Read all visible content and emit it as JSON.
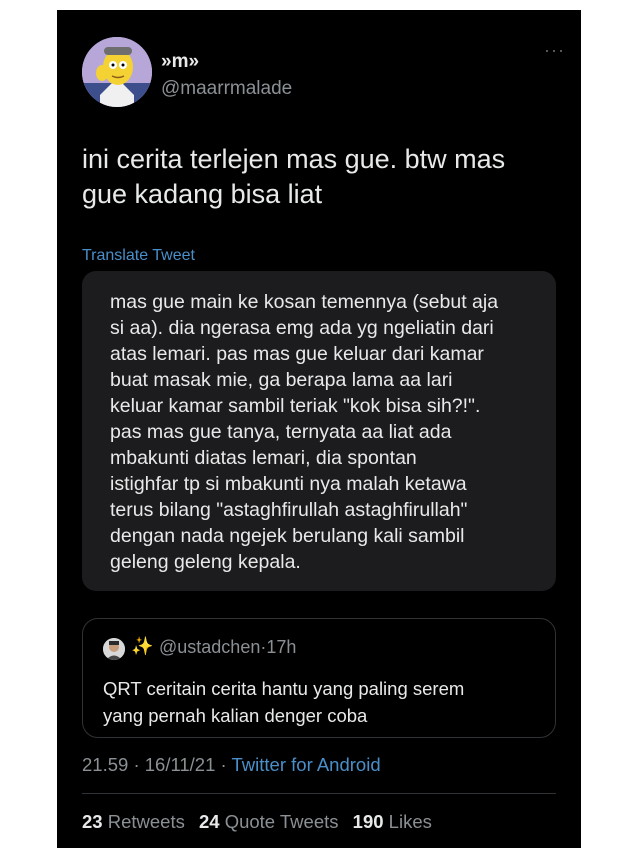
{
  "author": {
    "display_name": "»m»",
    "handle": "@maarrmalade"
  },
  "more_label": "···",
  "tweet_text": "ini cerita terlejen mas gue. btw mas\ngue kadang bisa liat",
  "translate_label": "Translate Tweet",
  "media_text": "mas gue main ke kosan temennya (sebut aja\nsi aa). dia ngerasa emg ada yg ngeliatin dari\natas lemari. pas mas gue keluar dari kamar\nbuat masak mie, ga berapa lama aa lari\nkeluar kamar sambil teriak \"kok bisa sih?!\".\npas mas gue tanya, ternyata aa liat ada\nmbakunti diatas lemari, dia spontan\nistighfar tp si mbakunti nya malah ketawa\nterus bilang \"astaghfirullah astaghfirullah\"\ndengan nada ngejek berulang kali sambil\ngeleng geleng kepala.",
  "quote": {
    "sparkle": "✨",
    "handle": "@ustadchen",
    "separator": "·",
    "time": "17h",
    "text": "QRT ceritain cerita hantu yang paling serem\nyang pernah kalian denger coba"
  },
  "meta": {
    "time": "21.59",
    "sep1": "·",
    "date": "16/11/21",
    "sep2": "·",
    "source": "Twitter for Android"
  },
  "stats": {
    "retweets_count": "23",
    "retweets_label": "Retweets",
    "quotes_count": "24",
    "quotes_label": "Quote Tweets",
    "likes_count": "190",
    "likes_label": "Likes"
  }
}
